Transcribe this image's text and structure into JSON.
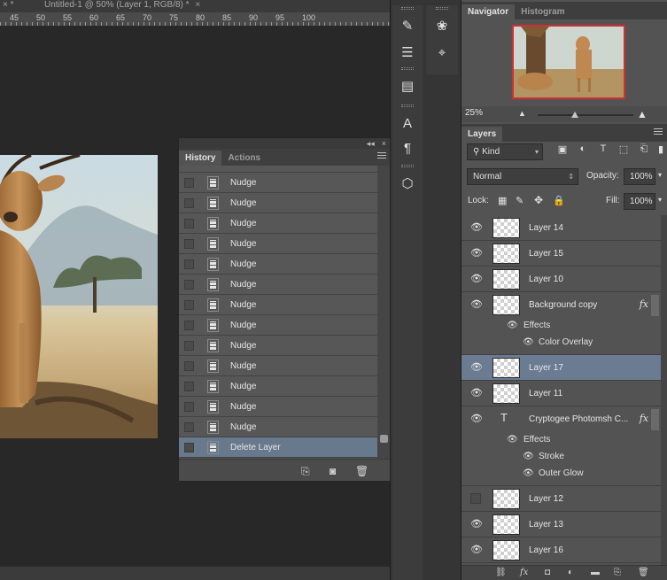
{
  "document": {
    "tabs": [
      {
        "label": "× *"
      },
      {
        "label": "Untitled-1 @ 50% (Layer 1, RGB/8) *",
        "close": "×"
      }
    ],
    "ruler_labels": [
      "45",
      "50",
      "55",
      "60",
      "65",
      "70",
      "75",
      "80",
      "85",
      "90",
      "95",
      "100"
    ]
  },
  "history_panel": {
    "tabs": [
      "History",
      "Actions"
    ],
    "collapse_glyph": "◂◂",
    "close_glyph": "×",
    "items": [
      {
        "label": "Nudge",
        "selected": false
      },
      {
        "label": "Nudge",
        "selected": false
      },
      {
        "label": "Nudge",
        "selected": false
      },
      {
        "label": "Nudge",
        "selected": false
      },
      {
        "label": "Nudge",
        "selected": false
      },
      {
        "label": "Nudge",
        "selected": false
      },
      {
        "label": "Nudge",
        "selected": false
      },
      {
        "label": "Nudge",
        "selected": false
      },
      {
        "label": "Nudge",
        "selected": false
      },
      {
        "label": "Nudge",
        "selected": false
      },
      {
        "label": "Nudge",
        "selected": false
      },
      {
        "label": "Nudge",
        "selected": false
      },
      {
        "label": "Nudge",
        "selected": false
      },
      {
        "label": "Delete Layer",
        "selected": true
      }
    ]
  },
  "navigator": {
    "tabs": [
      "Navigator",
      "Histogram"
    ],
    "zoom": "25%"
  },
  "layers_panel": {
    "tab": "Layers",
    "filter_kind": "Kind",
    "blend_mode": "Normal",
    "opacity_label": "Opacity:",
    "opacity": "100%",
    "lock_label": "Lock:",
    "fill_label": "Fill:",
    "fill": "100%",
    "fx_glyph": "fx",
    "effects_label": "Effects",
    "layers": [
      {
        "name": "Layer 14",
        "visible": true,
        "selected": false
      },
      {
        "name": "Layer 15",
        "visible": true,
        "selected": false
      },
      {
        "name": "Layer 10",
        "visible": true,
        "selected": false
      },
      {
        "name": "Background copy",
        "visible": true,
        "selected": false,
        "fx": true,
        "effects": [
          "Color Overlay"
        ]
      },
      {
        "name": "Layer 17",
        "visible": true,
        "selected": true
      },
      {
        "name": "Layer 11",
        "visible": true,
        "selected": false
      },
      {
        "name": "Cryptogee Photomsh C...",
        "visible": true,
        "selected": false,
        "type": "text",
        "fx": true,
        "effects": [
          "Stroke",
          "Outer Glow"
        ]
      },
      {
        "name": "Layer 12",
        "visible": false,
        "selected": false
      },
      {
        "name": "Layer 13",
        "visible": true,
        "selected": false
      },
      {
        "name": "Layer 16",
        "visible": true,
        "selected": false
      }
    ]
  },
  "colors": {
    "panel_bg": "#535353",
    "selection": "#6b7b92",
    "navigator_view_box": "#d03030"
  }
}
